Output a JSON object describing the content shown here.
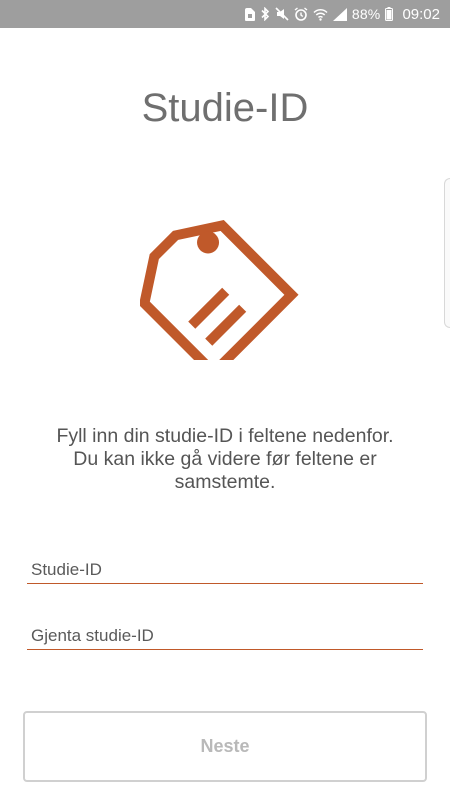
{
  "status_bar": {
    "battery": "88%",
    "time": "09:02",
    "icons": [
      "sim-icon",
      "bluetooth-icon",
      "mute-icon",
      "alarm-icon",
      "wifi-icon",
      "signal-icon",
      "battery-icon"
    ]
  },
  "page": {
    "title": "Studie-ID",
    "icon": "tag-icon",
    "accent_color": "#c0592a",
    "instructions": [
      "Fyll inn din studie-ID i feltene nedenfor.",
      "Du kan ikke gå videre før feltene er",
      "samstemte."
    ]
  },
  "form": {
    "study_id": {
      "placeholder": "Studie-ID",
      "value": ""
    },
    "repeat_study_id": {
      "placeholder": "Gjenta studie-ID",
      "value": ""
    },
    "next_label": "Neste"
  }
}
